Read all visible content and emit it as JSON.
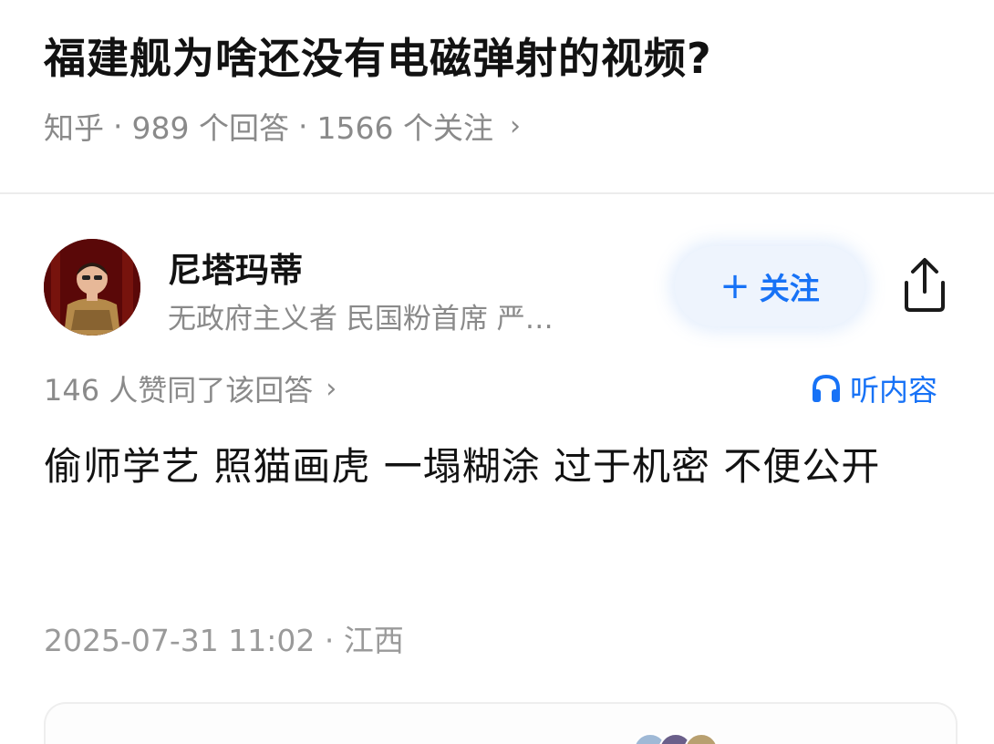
{
  "question": {
    "title": "福建舰为啥还没有电磁弹射的视频?",
    "source": "知乎",
    "separator": "·",
    "answers_count": "989 个回答",
    "followers_count": "1566 个关注",
    "chevron": "›"
  },
  "author": {
    "name": "尼塔玛蒂",
    "bio": "无政府主义者 民国粉首席 严…",
    "follow_plus": "+",
    "follow_label": "关注"
  },
  "answer": {
    "votes": "146 人赞同了该回答",
    "votes_chevron": "›",
    "listen_label": "听内容",
    "text": "偷师学艺 照猫画虎 一塌糊涂 过于机密 不便公开",
    "timestamp": "2025-07-31 11:02 · 江西"
  },
  "colors": {
    "accent": "#1772f6",
    "muted": "#8a8a8a",
    "title": "#121212"
  },
  "icons": {
    "share": "share-icon",
    "headphones": "headphones-icon",
    "chevron": "chevron-right-icon"
  }
}
